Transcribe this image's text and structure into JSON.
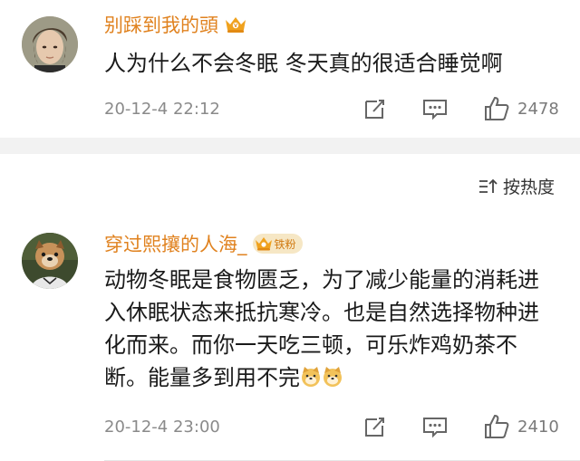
{
  "comments": [
    {
      "author": "别踩到我的頭",
      "text": "人为什么不会冬眠 冬天真的很适合睡觉啊",
      "timestamp": "20-12-4 22:12",
      "likes": "2478",
      "badge": "crown-badge"
    },
    {
      "author": "穿过熙攘的人海_",
      "fan_badge": "铁粉",
      "text": "动物冬眠是食物匮乏，为了减少能量的消耗进入休眠状态来抵抗寒冷。也是自然选择物种进化而来。而你一天吃三顿，可乐炸鸡奶茶不断。能量多到用不完",
      "emojis": [
        "doge-emoji",
        "doge-emoji"
      ],
      "timestamp": "20-12-4 23:00",
      "likes": "2410",
      "badge": "crown-badge"
    }
  ],
  "sort": {
    "label": "按热度",
    "icon": "sort-icon"
  },
  "colors": {
    "author": "#e0821f",
    "text": "#1a1a1a",
    "meta": "#8a8a8a",
    "divider": "#f2f2f2",
    "badge_bg": "#f6e7c5"
  }
}
